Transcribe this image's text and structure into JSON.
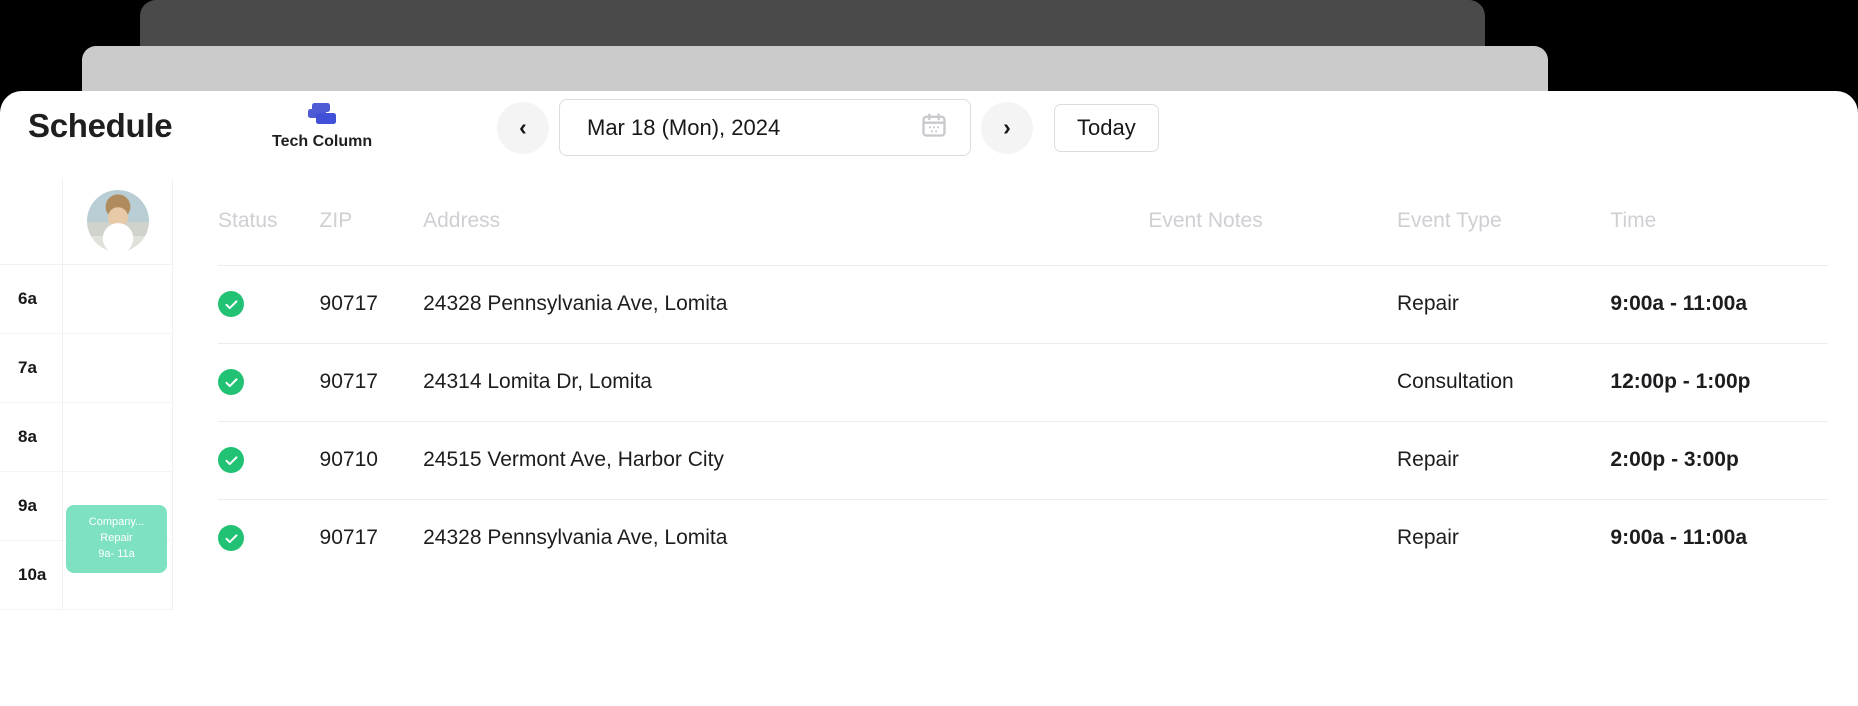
{
  "header": {
    "title": "Schedule",
    "tech_column_label": "Tech Column",
    "prev_icon": "chevron-left-icon",
    "next_icon": "chevron-right-icon",
    "calendar_icon": "calendar-icon",
    "tech_column_icon": "stacked-cards-icon",
    "date_value": "Mar 18 (Mon), 2024",
    "today_label": "Today"
  },
  "calendar_rail": {
    "avatar_name": "technician-avatar",
    "time_labels": [
      "6a",
      "7a",
      "8a",
      "9a",
      "10a"
    ],
    "event": {
      "title": "Company...",
      "type": "Repair",
      "time": "9a- 11a",
      "color": "#7ee2c2"
    }
  },
  "table": {
    "columns": [
      "Status",
      "ZIP",
      "Address",
      "Event Notes",
      "Event Type",
      "Time"
    ],
    "status_icon": "check-circle-icon",
    "status_color": "#22c274",
    "rows": [
      {
        "status": "complete",
        "zip": "90717",
        "address": "24328 Pennsylvania Ave, Lomita",
        "notes": "",
        "event_type": "Repair",
        "time": "9:00a - 11:00a"
      },
      {
        "status": "complete",
        "zip": "90717",
        "address": "24314 Lomita Dr, Lomita",
        "notes": "",
        "event_type": "Consultation",
        "time": "12:00p - 1:00p"
      },
      {
        "status": "complete",
        "zip": "90710",
        "address": "24515 Vermont Ave, Harbor City",
        "notes": "",
        "event_type": "Repair",
        "time": "2:00p - 3:00p"
      },
      {
        "status": "complete",
        "zip": "90717",
        "address": "24328 Pennsylvania Ave, Lomita",
        "notes": "",
        "event_type": "Repair",
        "time": "9:00a - 11:00a"
      }
    ]
  }
}
